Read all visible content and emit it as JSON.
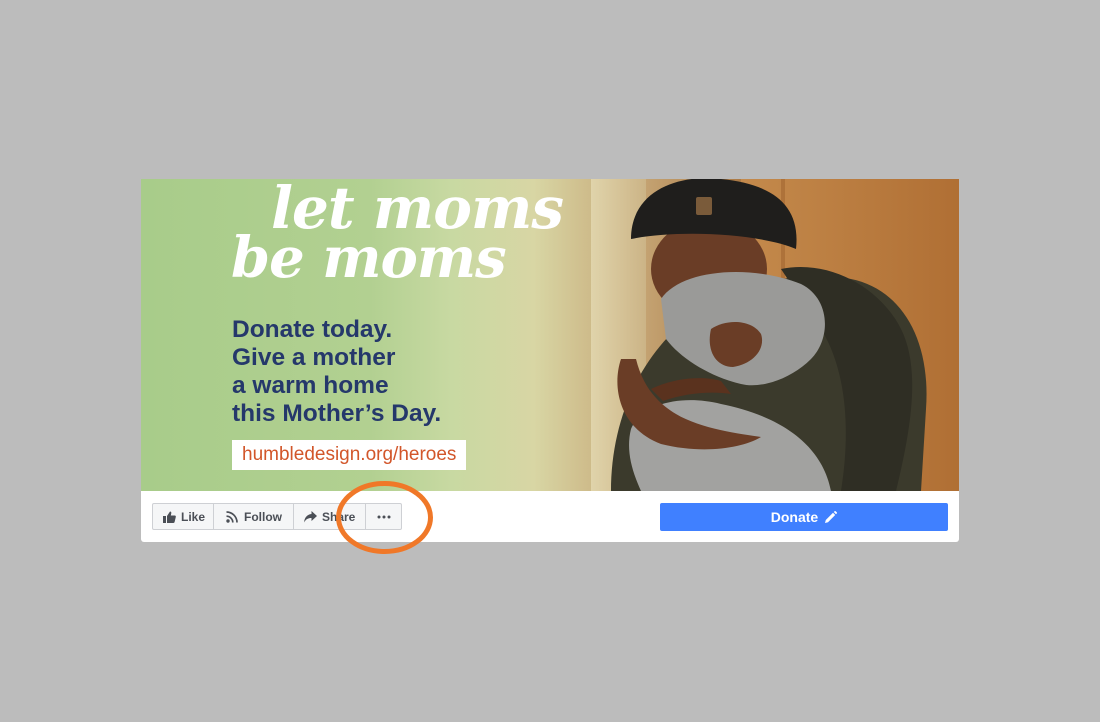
{
  "cover": {
    "script_title_line1": "let moms",
    "script_title_line2": "be moms",
    "tagline_lines": [
      "Donate today.",
      "Give a mother",
      "a warm home",
      "this Mother’s Day."
    ],
    "url": "humbledesign.org/heroes"
  },
  "actions": {
    "like": {
      "label": "Like",
      "icon": "thumbs-up-icon"
    },
    "follow": {
      "label": "Follow",
      "icon": "rss-icon"
    },
    "share": {
      "label": "Share",
      "icon": "share-arrow-icon"
    },
    "more": {
      "icon": "more-dots-icon"
    }
  },
  "donate": {
    "label": "Donate",
    "icon": "pencil-icon",
    "color": "#4080ff"
  },
  "annotation": {
    "ring_color": "#f07828"
  }
}
